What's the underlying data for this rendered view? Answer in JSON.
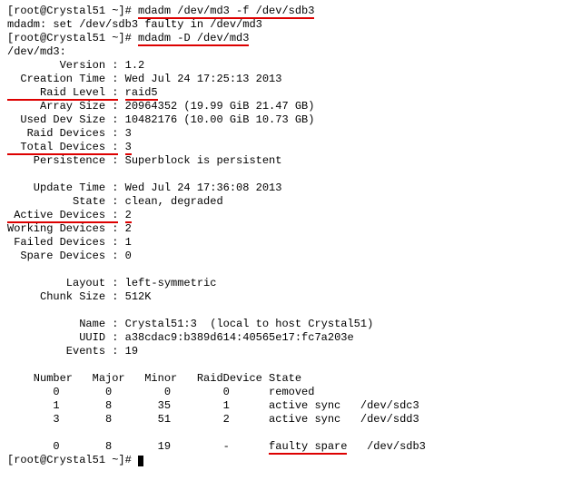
{
  "prompt1": "[root@Crystal51 ~]# ",
  "cmd1": "mdadm /dev/md3 -f /dev/sdb3",
  "out_faulty": "mdadm: set /dev/sdb3 faulty in /dev/md3",
  "prompt2": "[root@Crystal51 ~]# ",
  "cmd2": "mdadm -D /dev/md3",
  "dev_line": "/dev/md3:",
  "kv": {
    "version_k": "        Version : ",
    "version_v": "1.2",
    "ctime_k": "  Creation Time : ",
    "ctime_v": "Wed Jul 24 17:25:13 2013",
    "raidlevel_k": "     Raid Level :",
    "raidlevel_sp": " ",
    "raidlevel_v": "raid5",
    "arraysize_k": "     Array Size : ",
    "arraysize_v": "20964352 (19.99 GiB 21.47 GB)",
    "useddev_k": "  Used Dev Size : ",
    "useddev_v": "10482176 (10.00 GiB 10.73 GB)",
    "raiddev_k": "   Raid Devices : ",
    "raiddev_v": "3",
    "totaldev_k": "  Total Devices :",
    "totaldev_sp": " ",
    "totaldev_v": "3",
    "persist_k": "    Persistence : ",
    "persist_v": "Superblock is persistent",
    "utime_k": "    Update Time : ",
    "utime_v": "Wed Jul 24 17:36:08 2013",
    "state_k": "          State : ",
    "state_v": "clean, degraded",
    "active_k": " Active Devices :",
    "active_sp": " ",
    "active_v": "2",
    "working_k": "Working Devices : ",
    "working_v": "2",
    "failed_k": " Failed Devices : ",
    "failed_v": "1",
    "spare_k": "  Spare Devices : ",
    "spare_v": "0",
    "layout_k": "         Layout : ",
    "layout_v": "left-symmetric",
    "chunk_k": "     Chunk Size : ",
    "chunk_v": "512K",
    "name_k": "           Name : ",
    "name_v": "Crystal51:3  (local to host Crystal51)",
    "uuid_k": "           UUID : ",
    "uuid_v": "a38cdac9:b389d614:40565e17:fc7a203e",
    "events_k": "         Events : ",
    "events_v": "19"
  },
  "table": {
    "hdr": "    Number   Major   Minor   RaidDevice State",
    "row0": "       0       0        0        0      removed",
    "row1": "       1       8       35        1      active sync   /dev/sdc3",
    "row2": "       3       8       51        2      active sync   /dev/sdd3",
    "row3a": "       0       8       19        -      ",
    "row3b": "faulty spare",
    "row3c": "   /dev/sdb3"
  },
  "prompt3": "[root@Crystal51 ~]# "
}
